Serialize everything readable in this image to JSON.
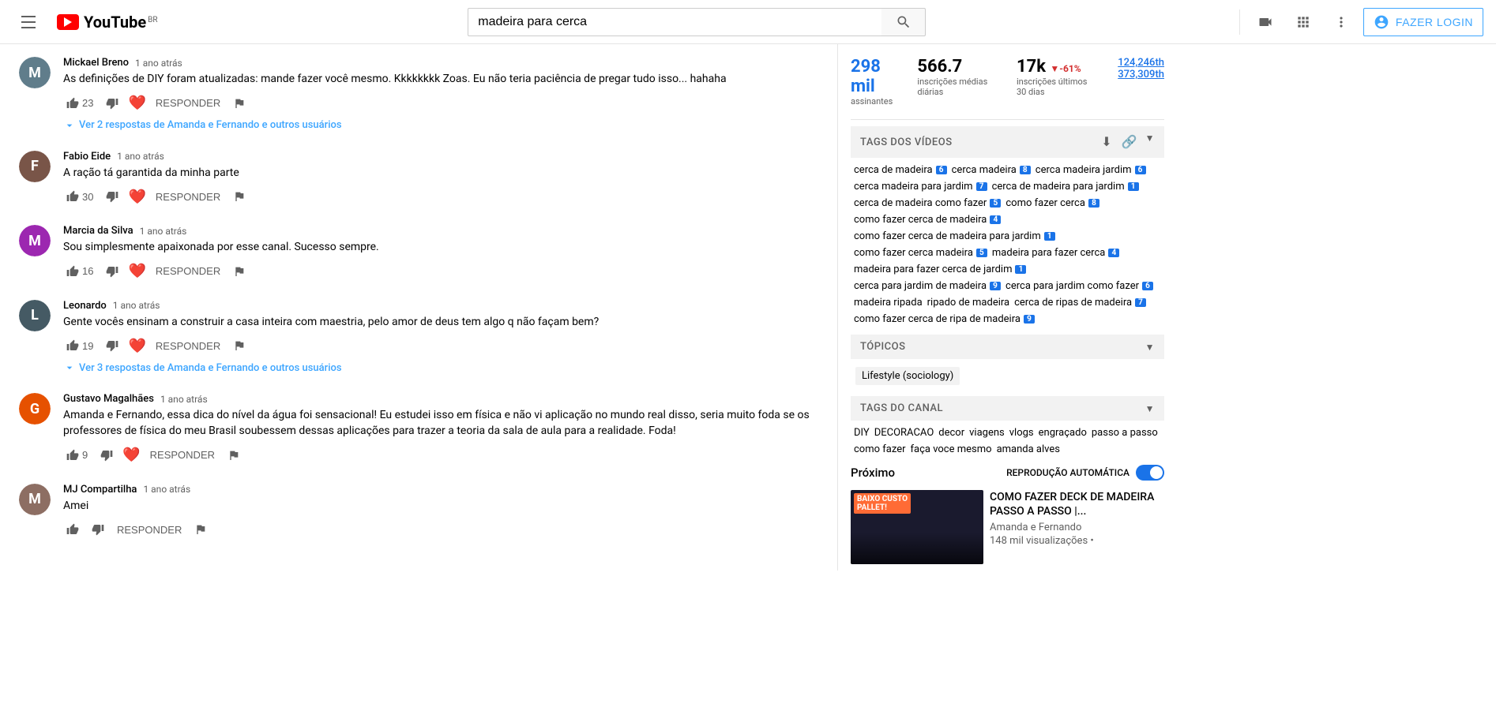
{
  "header": {
    "search_placeholder": "madeira para cerca",
    "country": "BR",
    "login_label": "FAZER LOGIN"
  },
  "stats": {
    "subscribers": "298 mil",
    "subscribers_label": "assinantes",
    "avg_inscriptions": "566.7",
    "avg_label": "inscrições médias diárias",
    "last30": "17k",
    "last30_change": "▼-61%",
    "last30_label": "inscrições últimos 30 dias",
    "link1": "124,246th",
    "link2": "373,309th"
  },
  "sections": {
    "tags_videos": "TAGS DOS VÍDEOS",
    "topics": "TÓPICOS",
    "tags_canal": "TAGS DO CANAL"
  },
  "video_tags": [
    {
      "text": "cerca de madeira",
      "rank": "6"
    },
    {
      "text": "cerca madeira",
      "rank": "8"
    },
    {
      "text": "cerca madeira jardim",
      "rank": "6"
    },
    {
      "text": "cerca madeira para jardim",
      "rank": "7"
    },
    {
      "text": "cerca de madeira para jardim",
      "rank": "1"
    },
    {
      "text": "cerca de madeira como fazer",
      "rank": "5"
    },
    {
      "text": "como fazer cerca",
      "rank": "8"
    },
    {
      "text": "como fazer cerca de madeira",
      "rank": "4"
    },
    {
      "text": "como fazer cerca de madeira para jardim",
      "rank": "1"
    },
    {
      "text": "como fazer cerca madeira",
      "rank": "5"
    },
    {
      "text": "madeira para fazer cerca",
      "rank": "4"
    },
    {
      "text": "madeira para fazer cerca de jardim",
      "rank": "1"
    },
    {
      "text": "cerca para jardim de madeira",
      "rank": "9"
    },
    {
      "text": "cerca para jardim como fazer",
      "rank": "6"
    },
    {
      "text": "madeira ripada",
      "rank": ""
    },
    {
      "text": "ripado de madeira",
      "rank": ""
    },
    {
      "text": "cerca de ripas de madeira",
      "rank": "7"
    },
    {
      "text": "como fazer cerca de ripa de madeira",
      "rank": "9"
    }
  ],
  "topics": [
    {
      "text": "Lifestyle (sociology)"
    }
  ],
  "channel_tags": [
    {
      "text": "DIY"
    },
    {
      "text": "DECORACAO"
    },
    {
      "text": "decor"
    },
    {
      "text": "viagens"
    },
    {
      "text": "vlogs"
    },
    {
      "text": "engraçado"
    },
    {
      "text": "passo a passo"
    },
    {
      "text": "como fazer"
    },
    {
      "text": "faça voce mesmo"
    },
    {
      "text": "amanda alves"
    }
  ],
  "comments": [
    {
      "id": "1",
      "author": "Mickael Breno",
      "time": "1 ano atrás",
      "text": "As definições de DIY foram atualizadas: mande fazer você mesmo. Kkkkkkkk Zoas. Eu não teria paciência de pregar tudo isso... hahaha",
      "likes": "23",
      "avatar_letter": "M",
      "avatar_class": "c1",
      "has_heart": true,
      "replies": "Ver 2 respostas de Amanda e Fernando e outros usuários"
    },
    {
      "id": "2",
      "author": "Fabio Eide",
      "time": "1 ano atrás",
      "text": "A ração tá garantida da minha parte",
      "likes": "30",
      "avatar_letter": "F",
      "avatar_class": "c2",
      "has_heart": true,
      "replies": ""
    },
    {
      "id": "3",
      "author": "Marcia da Silva",
      "time": "1 ano atrás",
      "text": "Sou simplesmente apaixonada por esse canal. Sucesso sempre.",
      "likes": "16",
      "avatar_letter": "M",
      "avatar_class": "c3",
      "has_heart": true,
      "replies": ""
    },
    {
      "id": "4",
      "author": "Leonardo",
      "time": "1 ano atrás",
      "text": "Gente vocês ensinam a construir a casa inteira com maestria, pelo amor de deus tem algo q não façam bem?",
      "likes": "19",
      "avatar_letter": "L",
      "avatar_class": "c4",
      "has_heart": true,
      "replies": "Ver 3 respostas de Amanda e Fernando e outros usuários"
    },
    {
      "id": "5",
      "author": "Gustavo Magalhães",
      "time": "1 ano atrás",
      "text": "Amanda e Fernando, essa dica do nível da água foi sensacional! Eu estudei isso em física e não vi aplicação no mundo real disso, seria muito foda se os professores de física do meu Brasil soubessem dessas aplicações para trazer a teoria da sala de aula para a realidade. Foda!",
      "likes": "9",
      "avatar_letter": "G",
      "avatar_class": "c5",
      "has_heart": true,
      "replies": ""
    },
    {
      "id": "6",
      "author": "MJ Compartilha",
      "time": "1 ano atrás",
      "text": "Amei",
      "likes": "",
      "avatar_letter": "M",
      "avatar_class": "c7",
      "has_heart": false,
      "replies": ""
    }
  ],
  "next": {
    "label": "Próximo",
    "auto_play": "REPRODUÇÃO AUTOMÁTICA",
    "video_title": "COMO FAZER DECK DE MADEIRA PASSO A PASSO |...",
    "video_channel": "Amanda e Fernando",
    "video_views": "148 mil visualizações •",
    "thumb_text": "BAIXO CUSTO PALLET!"
  }
}
